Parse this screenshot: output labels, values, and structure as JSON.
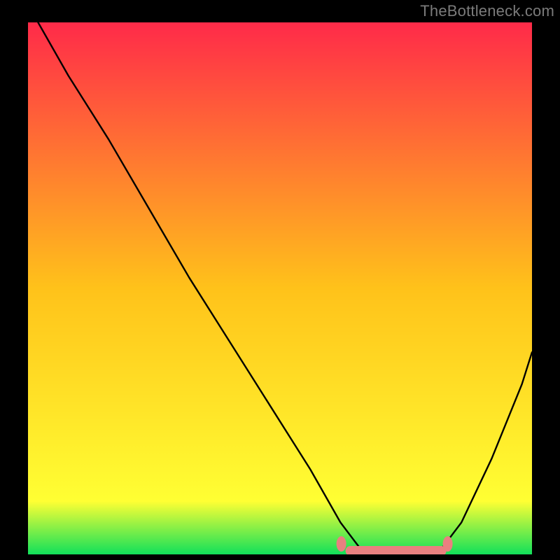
{
  "attribution": "TheBottleneck.com",
  "chart_data": {
    "type": "line",
    "title": "",
    "xlabel": "",
    "ylabel": "",
    "xlim": [
      0,
      100
    ],
    "ylim": [
      0,
      100
    ],
    "background_gradient": {
      "top": "#ff2a49",
      "upper_mid": "#ffc21a",
      "lower_mid": "#ffff33",
      "bottom": "#11e05a"
    },
    "curve": {
      "name": "bottleneck-curve",
      "color": "#000000",
      "points": [
        {
          "x": 2,
          "y": 100
        },
        {
          "x": 8,
          "y": 90
        },
        {
          "x": 16,
          "y": 78
        },
        {
          "x": 24,
          "y": 65
        },
        {
          "x": 32,
          "y": 52
        },
        {
          "x": 40,
          "y": 40
        },
        {
          "x": 48,
          "y": 28
        },
        {
          "x": 56,
          "y": 16
        },
        {
          "x": 62,
          "y": 6
        },
        {
          "x": 66,
          "y": 1
        },
        {
          "x": 72,
          "y": 0
        },
        {
          "x": 78,
          "y": 0
        },
        {
          "x": 82,
          "y": 1
        },
        {
          "x": 86,
          "y": 6
        },
        {
          "x": 92,
          "y": 18
        },
        {
          "x": 98,
          "y": 32
        },
        {
          "x": 100,
          "y": 38
        }
      ]
    },
    "flat_band": {
      "color": "#e98080",
      "x_start": 63,
      "x_end": 83,
      "thickness_px": 14
    }
  }
}
